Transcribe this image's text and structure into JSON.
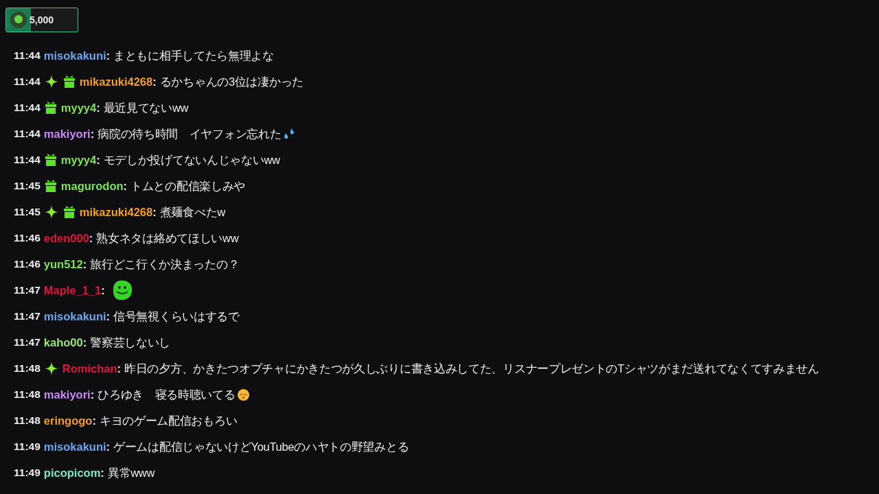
{
  "bits_badge": {
    "amount": "5,000"
  },
  "messages": [
    {
      "time": "11:44",
      "user": "misokakuni",
      "separator": ":",
      "color": "#6ea7f0",
      "text": "まともに相手してたら無理よな"
    },
    {
      "time": "11:44",
      "badges": [
        {
          "kind": "sparkle"
        },
        {
          "kind": "gift"
        }
      ],
      "user": "mikazuki4268",
      "separator": ":",
      "color": "#f59e24",
      "text": "るかちゃんの3位は凄かった"
    },
    {
      "time": "11:44",
      "badges": [
        {
          "kind": "gift"
        }
      ],
      "user": "myyy4",
      "separator": ":",
      "color": "#7ee35a",
      "text": "最近見てないww"
    },
    {
      "time": "11:44",
      "user": "makiyori",
      "separator": ":",
      "color": "#c58af5",
      "text": "病院の待ち時間　イヤフォン忘れた",
      "emote": {
        "kind": "droplets"
      }
    },
    {
      "time": "11:44",
      "badges": [
        {
          "kind": "gift"
        }
      ],
      "user": "myyy4",
      "separator": ":",
      "color": "#7ee35a",
      "text": "モデしか投げてないんじゃないww"
    },
    {
      "time": "11:45",
      "badges": [
        {
          "kind": "gift"
        }
      ],
      "user": "magurodon",
      "separator": ":",
      "color": "#7ee35a",
      "text": "トムとの配信楽しみや"
    },
    {
      "time": "11:45",
      "badges": [
        {
          "kind": "sparkle"
        },
        {
          "kind": "gift"
        }
      ],
      "user": "mikazuki4268",
      "separator": ":",
      "color": "#f59e24",
      "text": "煮麺食べたw"
    },
    {
      "time": "11:46",
      "user": "eden000",
      "separator": ":",
      "color": "#e0163f",
      "text": "熟女ネタは絡めてほしいww"
    },
    {
      "time": "11:46",
      "user": "yun512",
      "separator": ":",
      "color": "#7ee35a",
      "text": "旅行どこ行くか決まったの？"
    },
    {
      "time": "11:47",
      "user": "Maple_1_1",
      "separator": ":",
      "color": "#e0163f",
      "emote": {
        "kind": "blob"
      }
    },
    {
      "time": "11:47",
      "user": "misokakuni",
      "separator": ":",
      "color": "#6ea7f0",
      "text": "信号無視くらいはするで"
    },
    {
      "time": "11:47",
      "user": "kaho00",
      "separator": ":",
      "color": "#9be87a",
      "text": "警察芸しないし"
    },
    {
      "time": "11:48",
      "badges": [
        {
          "kind": "sparkle"
        }
      ],
      "user": "Romichan",
      "separator": ":",
      "color": "#e0163f",
      "text": "昨日の夕方、かきたつオプチャにかきたつが久しぶりに書き込みしてた、リスナープレゼントのTシャツがまだ送れてなくてすみません"
    },
    {
      "time": "11:48",
      "user": "makiyori",
      "separator": ":",
      "color": "#c58af5",
      "text": "ひろゆき　寝る時聴いてる",
      "emote": {
        "kind": "sleepy"
      }
    },
    {
      "time": "11:48",
      "user": "eringogo",
      "separator": ":",
      "color": "#f59e24",
      "text": "キヨのゲーム配信おもろい"
    },
    {
      "time": "11:49",
      "user": "misokakuni",
      "separator": ":",
      "color": "#6ea7f0",
      "text": "ゲームは配信じゃないけどYouTubeのハヤトの野望みとる"
    },
    {
      "time": "11:49",
      "user": "picopicom",
      "separator": ":",
      "color": "#7ee8c8",
      "text": "異常www"
    }
  ]
}
